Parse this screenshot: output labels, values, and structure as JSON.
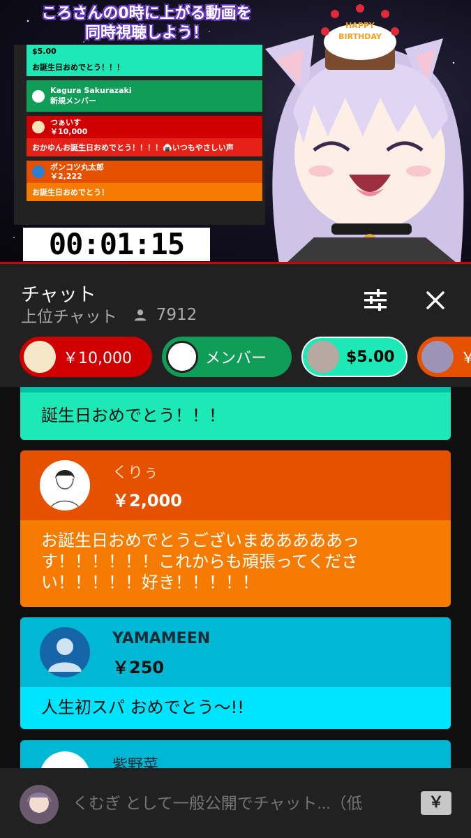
{
  "video": {
    "title_line1": "ころさんの0時に上がる動画を",
    "title_line2": "同時視聴しよう！",
    "timer": "00:01:15",
    "cake_text_1": "HAPPY",
    "cake_text_2": "BIRTHDAY",
    "overlay_chat": [
      {
        "name": "",
        "amount": "$5.00",
        "message": "お誕生日おめでとう！！！",
        "color": "#1de9b6"
      },
      {
        "name": "Kagura Sakurazaki",
        "amount": "新規メンバー",
        "message": "",
        "color": "#0f9d58"
      },
      {
        "name": "つぁいす",
        "amount": "￥10,000",
        "message": "おかゆんお誕生日おめでとう！！！！🍙いつもやさしい声",
        "color": "#d00000"
      },
      {
        "name": "ポンコツ丸太郎",
        "amount": "￥2,222",
        "message": "お誕生日おめでとう！",
        "color": "#e65100"
      }
    ]
  },
  "chat_header": {
    "title": "チャット",
    "mode": "上位チャット",
    "viewer_count": "7912"
  },
  "tickers": [
    {
      "label": "￥10,000",
      "color": "#d00000"
    },
    {
      "label": "メンバー",
      "color": "#0f9d58"
    },
    {
      "label": "$5.00",
      "color": "#1de9b6"
    },
    {
      "label": "￥",
      "color": "#e65100"
    }
  ],
  "messages": [
    {
      "author": "",
      "amount": "",
      "text": "誕生日おめでとう！！！",
      "color": "#1de9b6"
    },
    {
      "author": "くりぅ",
      "amount": "￥2,000",
      "text_lines": [
        "お誕生日おめでとうございまあああああっ",
        "す！！！！！！これからも頑張ってくださ",
        "い！！！！！好き！！！！！"
      ],
      "color": "#e65100"
    },
    {
      "author": "YAMAMEEN",
      "amount": "￥250",
      "text": "人生初スパ おめでとう〜!!",
      "color": "#00b8d4"
    },
    {
      "author": "紫野菜",
      "amount": "",
      "text": "",
      "color": "#00b8d4"
    }
  ],
  "input": {
    "placeholder": "くむぎ として一般公開でチャット...（低",
    "super_chat_symbol": "￥"
  },
  "icons": {
    "filter": "tune-icon",
    "close": "close-icon",
    "viewers": "person-icon",
    "default_avatar": "default-avatar-icon"
  }
}
